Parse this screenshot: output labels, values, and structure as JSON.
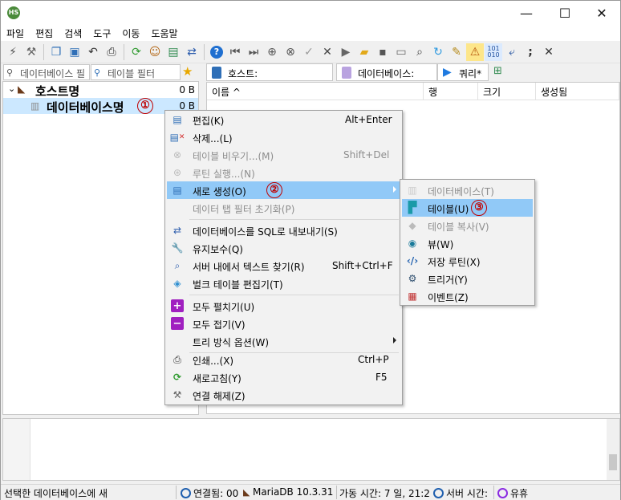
{
  "colors": {
    "accent": "#91c9f7",
    "selection": "#cce8ff",
    "annotation": "#c00000"
  },
  "window": {
    "minimize": "—",
    "maximize": "☐",
    "close": "✕"
  },
  "menubar": [
    "파일",
    "편집",
    "검색",
    "도구",
    "이동",
    "도움말"
  ],
  "filters": {
    "db_filter": "데이터베이스 필",
    "table_filter": "테이블 필터"
  },
  "tabs": {
    "host": "호스트:",
    "database": "데이터베이스:",
    "query": "쿼리*"
  },
  "tree": {
    "host": {
      "label": "호스트명",
      "size": "0 B"
    },
    "database": {
      "label": "데이터베이스명",
      "size": "0 B",
      "marker": "①"
    }
  },
  "grid": {
    "columns": [
      "이름 ^",
      "행",
      "크기",
      "생성됨"
    ]
  },
  "context_menu": {
    "items": [
      {
        "label": "편집(K)",
        "shortcut": "Alt+Enter",
        "icon": "edit-icon",
        "disabled": false
      },
      {
        "label": "삭제...(L)",
        "shortcut": "",
        "icon": "delete-icon",
        "disabled": false
      },
      {
        "label": "테이블 비우기...(M)",
        "shortcut": "Shift+Del",
        "icon": "empty-table-icon",
        "disabled": true
      },
      {
        "label": "루틴 실행...(N)",
        "shortcut": "",
        "icon": "run-routine-icon",
        "disabled": true
      },
      {
        "label": "새로 생성(O)",
        "shortcut": "",
        "icon": "create-new-icon",
        "disabled": false,
        "marker": "②"
      },
      {
        "label": "데이터 탭 필터 초기화(P)",
        "shortcut": "",
        "icon": "",
        "disabled": true
      },
      {
        "label": "데이터베이스를 SQL로 내보내기(S)",
        "shortcut": "",
        "icon": "export-sql-icon",
        "disabled": false
      },
      {
        "label": "유지보수(Q)",
        "shortcut": "",
        "icon": "wrench-icon",
        "disabled": false
      },
      {
        "label": "서버 내에서 텍스트 찾기(R)",
        "shortcut": "Shift+Ctrl+F",
        "icon": "search-icon",
        "disabled": false
      },
      {
        "label": "벌크 테이블 편집기(T)",
        "shortcut": "",
        "icon": "bulk-edit-icon",
        "disabled": false
      },
      {
        "label": "모두 펼치기(U)",
        "shortcut": "",
        "icon": "expand-all-icon",
        "disabled": false
      },
      {
        "label": "모두 접기(V)",
        "shortcut": "",
        "icon": "collapse-all-icon",
        "disabled": false
      },
      {
        "label": "트리 방식 옵션(W)",
        "shortcut": "",
        "icon": "",
        "disabled": false
      },
      {
        "label": "인쇄...(X)",
        "shortcut": "Ctrl+P",
        "icon": "print-icon",
        "disabled": false
      },
      {
        "label": "새로고침(Y)",
        "shortcut": "F5",
        "icon": "refresh-icon",
        "disabled": false
      },
      {
        "label": "연결 해제(Z)",
        "shortcut": "",
        "icon": "disconnect-icon",
        "disabled": false
      }
    ]
  },
  "submenu": {
    "items": [
      {
        "label": "데이터베이스(T)",
        "icon": "database-icon",
        "disabled": true
      },
      {
        "label": "테이블(U)",
        "icon": "table-icon",
        "disabled": false,
        "marker": "③"
      },
      {
        "label": "테이블 복사(V)",
        "icon": "copy-table-icon",
        "disabled": true
      },
      {
        "label": "뷰(W)",
        "icon": "view-icon",
        "disabled": false
      },
      {
        "label": "저장 루틴(X)",
        "icon": "stored-routine-icon",
        "disabled": false
      },
      {
        "label": "트리거(Y)",
        "icon": "trigger-icon",
        "disabled": false
      },
      {
        "label": "이벤트(Z)",
        "icon": "event-icon",
        "disabled": false
      }
    ]
  },
  "statusbar": {
    "message": "선택한 데이터베이스에 새",
    "connected": "연결됨: 00",
    "server": "MariaDB 10.3.31",
    "uptime": "가동 시간: 7 일, 21:2",
    "server_time": "서버 시간:",
    "idle": "유휴"
  }
}
